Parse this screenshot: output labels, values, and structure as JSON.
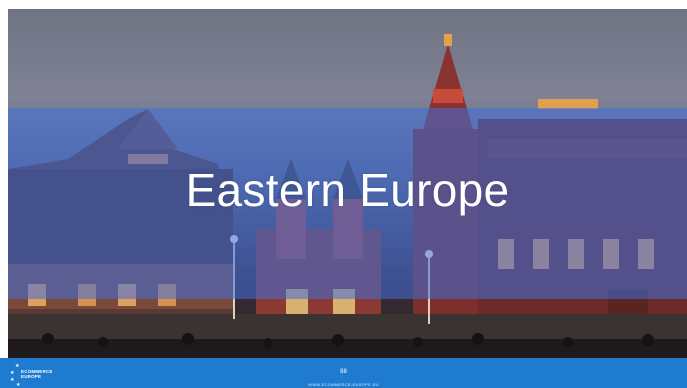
{
  "slide": {
    "title": "Eastern Europe",
    "page_number": "88",
    "footer_url": "WWW.ECOMMERCE-EUROPE.EU"
  },
  "logo": {
    "line1": "ECOMMERCE",
    "line2": "EUROPE"
  },
  "colors": {
    "footer_bar": "#1f7bd0",
    "title_band": "#4070dc",
    "title_text": "#ffffff"
  }
}
